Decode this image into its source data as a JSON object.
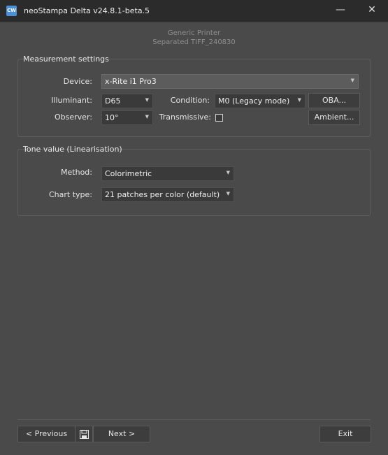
{
  "window": {
    "title": "neoStampa Delta  v24.8.1-beta.5",
    "app_icon_text": "CW",
    "minimize_glyph": "—",
    "close_glyph": "✕"
  },
  "header": {
    "printer": "Generic Printer",
    "job": "Separated TIFF_240830"
  },
  "measurement": {
    "title": "Measurement settings",
    "device_label": "Device:",
    "device_value": "x-Rite i1 Pro3",
    "illuminant_label": "Illuminant:",
    "illuminant_value": "D65",
    "condition_label": "Condition:",
    "condition_value": "M0 (Legacy mode)",
    "oba_button": "OBA...",
    "observer_label": "Observer:",
    "observer_value": "10°",
    "transmissive_label": "Transmissive:",
    "transmissive_checked": false,
    "ambient_button": "Ambient..."
  },
  "tone": {
    "title": "Tone value (Linearisation)",
    "method_label": "Method:",
    "method_value": "Colorimetric",
    "chart_type_label": "Chart type:",
    "chart_type_value": "21 patches per color (default)"
  },
  "footer": {
    "previous": "<  Previous",
    "next": "Next  >",
    "exit": "Exit"
  }
}
